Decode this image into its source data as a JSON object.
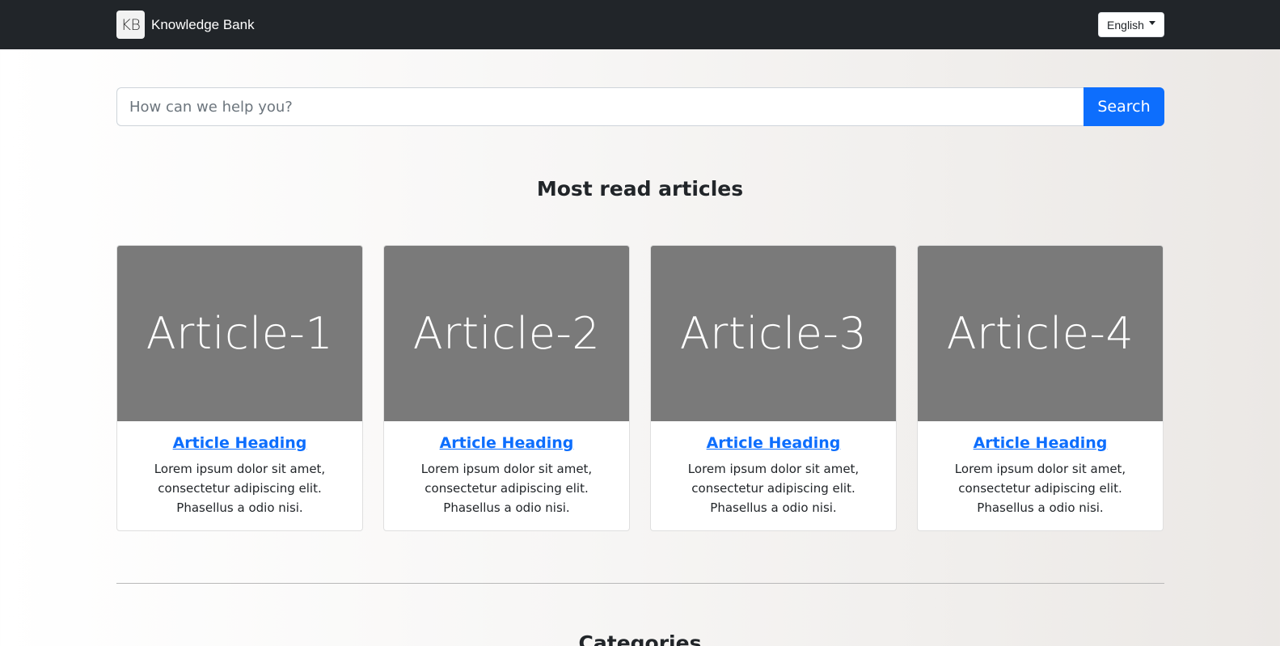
{
  "navbar": {
    "logo_text": "KB",
    "brand": "Knowledge Bank",
    "language": "English"
  },
  "search": {
    "placeholder": "How can we help you?",
    "button": "Search"
  },
  "articles_section": {
    "title": "Most read articles",
    "articles": [
      {
        "image_label": "Article-1",
        "heading": "Article Heading",
        "text": "Lorem ipsum dolor sit amet, consectetur adipiscing elit. Phasellus a odio nisi."
      },
      {
        "image_label": "Article-2",
        "heading": "Article Heading",
        "text": "Lorem ipsum dolor sit amet, consectetur adipiscing elit. Phasellus a odio nisi."
      },
      {
        "image_label": "Article-3",
        "heading": "Article Heading",
        "text": "Lorem ipsum dolor sit amet, consectetur adipiscing elit. Phasellus a odio nisi."
      },
      {
        "image_label": "Article-4",
        "heading": "Article Heading",
        "text": "Lorem ipsum dolor sit amet, consectetur adipiscing elit. Phasellus a odio nisi."
      }
    ]
  },
  "categories_section": {
    "title": "Categories"
  },
  "colors": {
    "navbar": "#212529",
    "primary": "#0d6efd",
    "image_placeholder": "#7a7a7a"
  }
}
